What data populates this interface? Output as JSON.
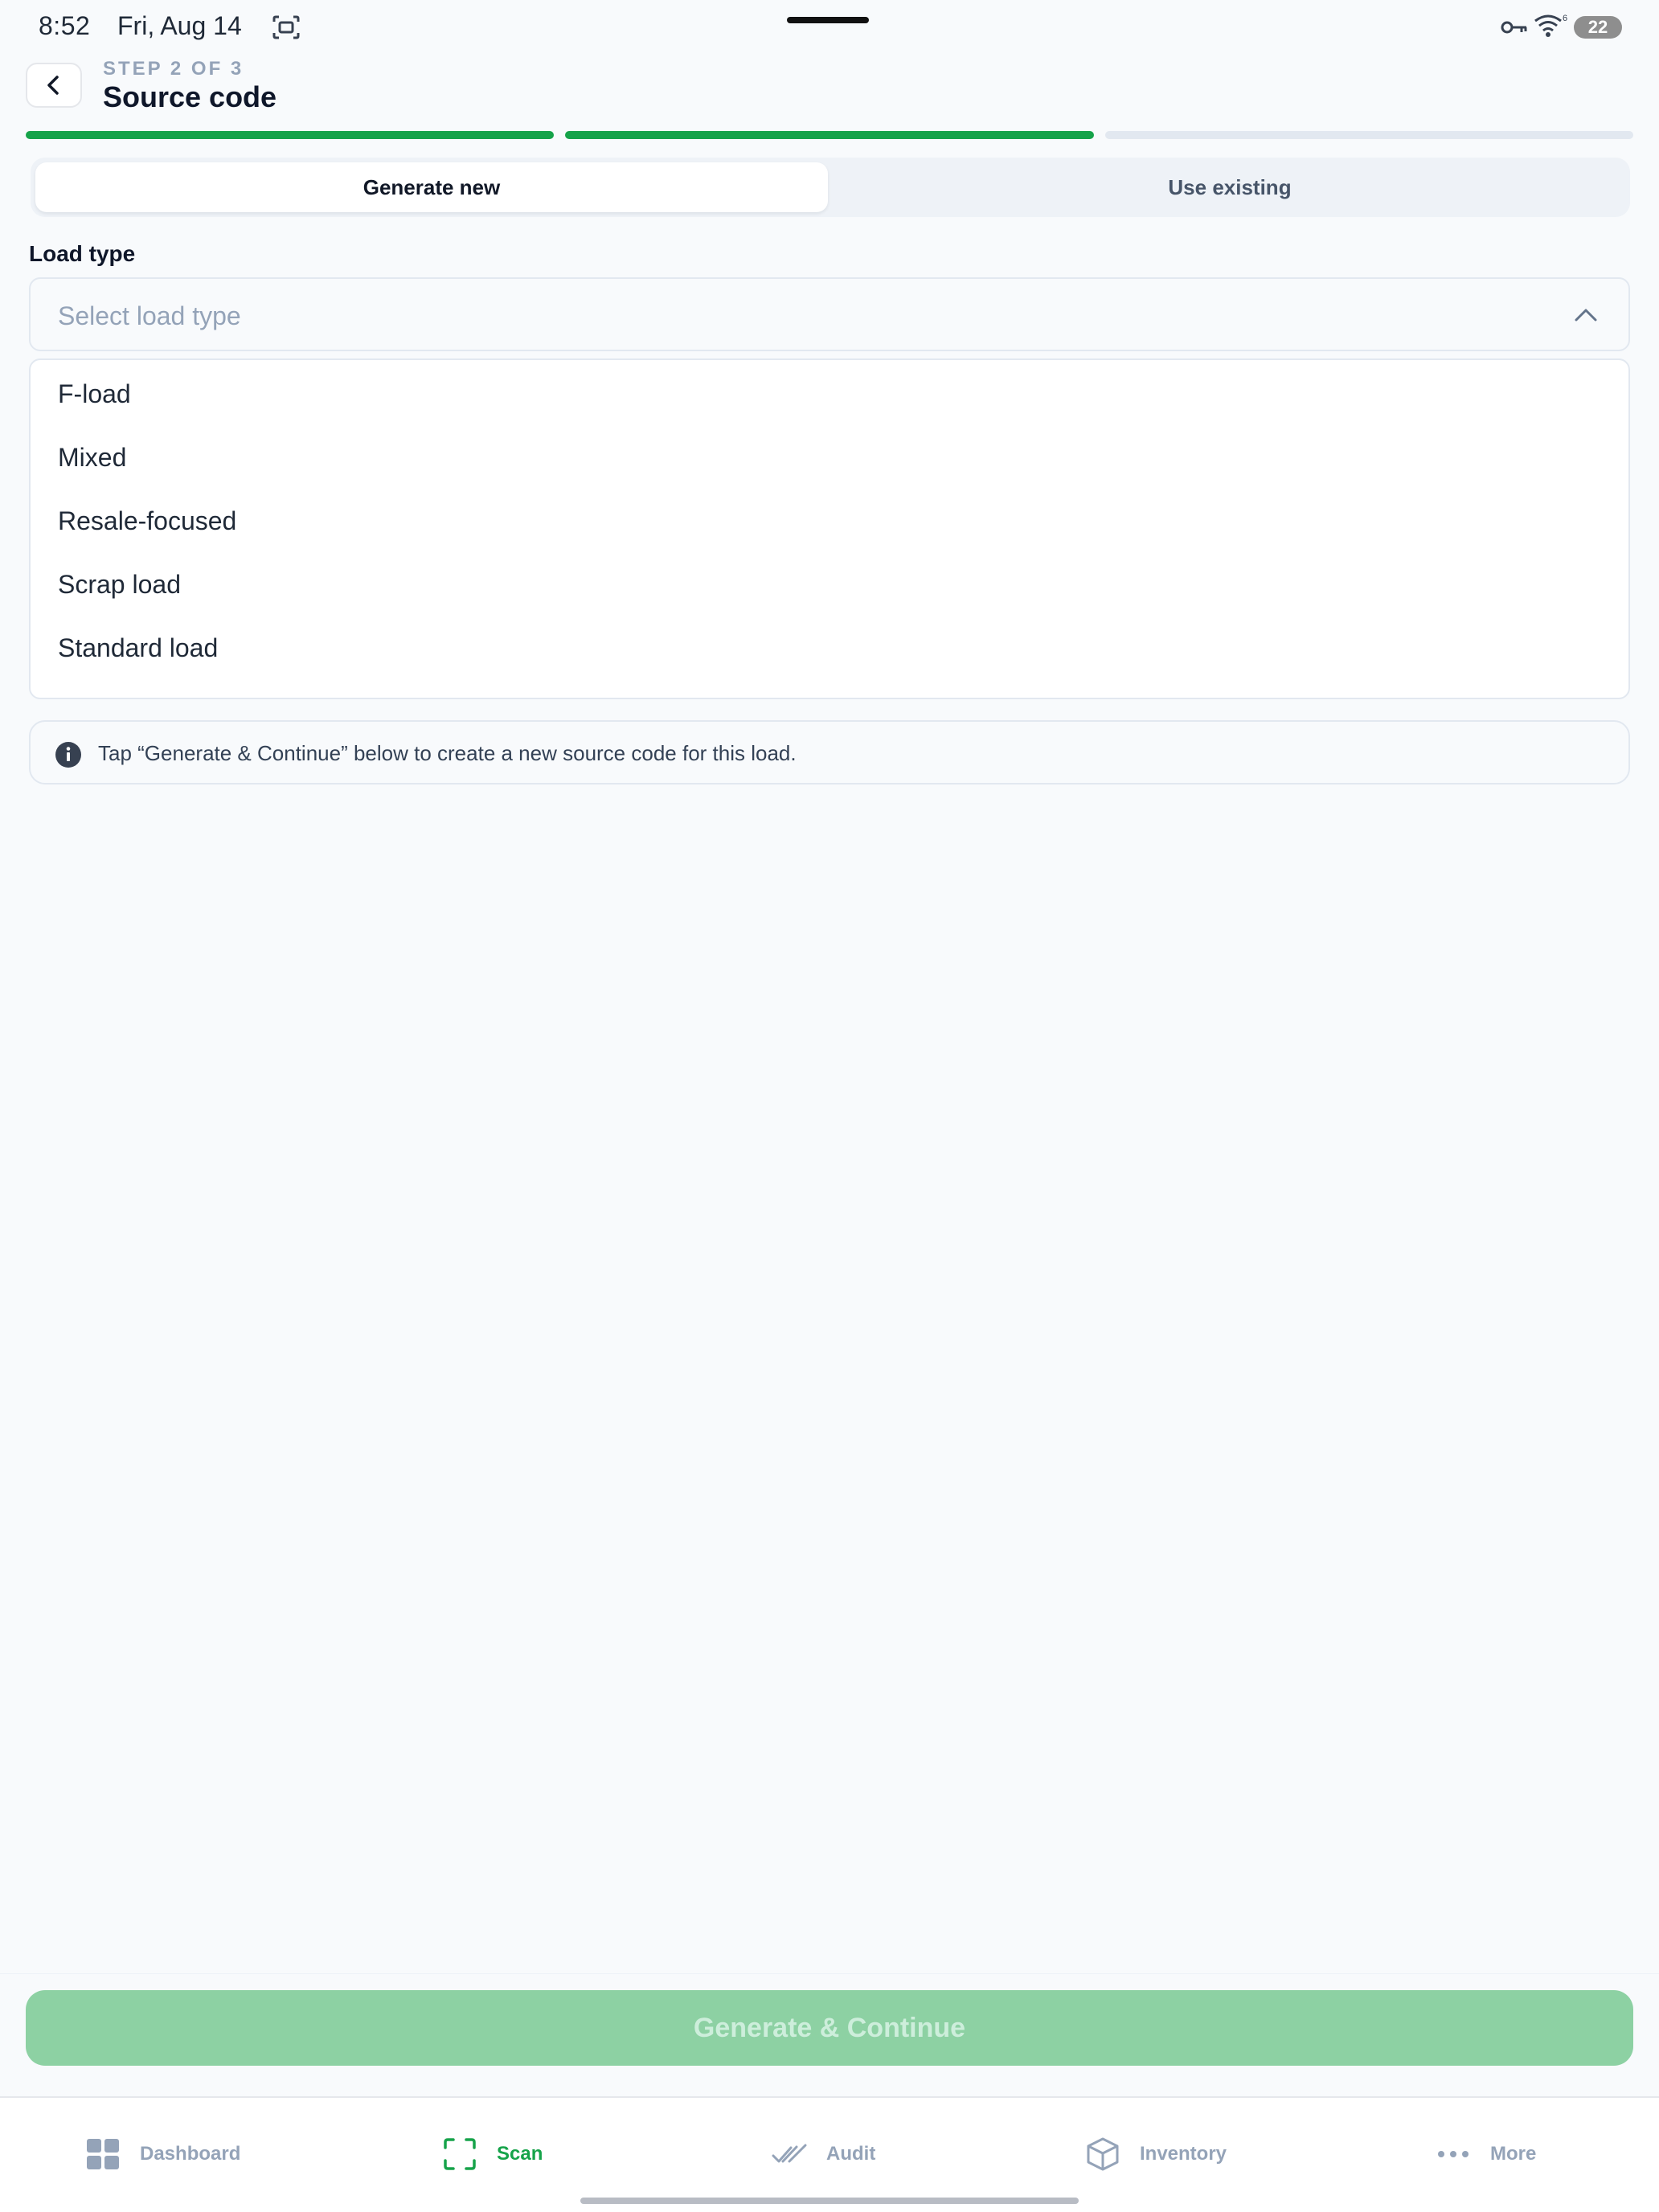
{
  "status_bar": {
    "time": "8:52",
    "date": "Fri, Aug 14",
    "battery": "22"
  },
  "header": {
    "step": "STEP 2 OF 3",
    "title": "Source code"
  },
  "progress": {
    "total_steps": 3,
    "completed_steps": 2
  },
  "mode_tabs": [
    {
      "label": "Generate new",
      "active": true
    },
    {
      "label": "Use existing",
      "active": false
    }
  ],
  "load_type": {
    "label": "Load type",
    "placeholder": "Select load type",
    "options": [
      "F-load",
      "Mixed",
      "Resale-focused",
      "Scrap load",
      "Standard load"
    ]
  },
  "info": {
    "text": "Tap “Generate & Continue” below to create a new source code for this load."
  },
  "primary_button": {
    "label": "Generate & Continue",
    "enabled": false
  },
  "tab_bar": [
    {
      "label": "Dashboard",
      "icon": "grid-icon",
      "active": false
    },
    {
      "label": "Scan",
      "icon": "scan-icon",
      "active": true
    },
    {
      "label": "Audit",
      "icon": "double-check-icon",
      "active": false
    },
    {
      "label": "Inventory",
      "icon": "cube-icon",
      "active": false
    },
    {
      "label": "More",
      "icon": "more-dots-icon",
      "active": false
    }
  ],
  "colors": {
    "accent": "#16a34a",
    "button_disabled": "#8dd1a3",
    "muted_text": "#94a3b8"
  }
}
